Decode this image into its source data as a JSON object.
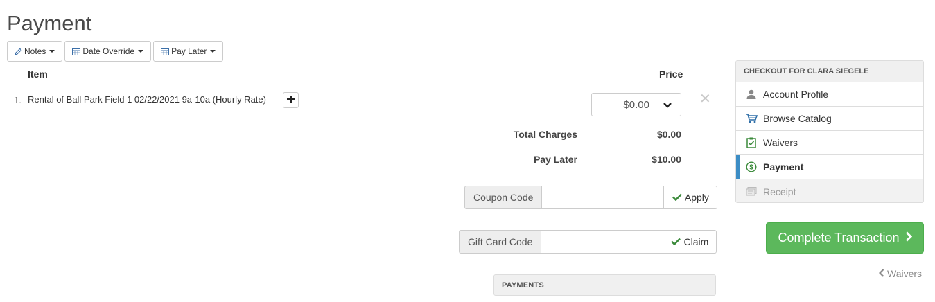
{
  "page": {
    "title": "Payment"
  },
  "toolbar": {
    "notes_label": "Notes",
    "date_override_label": "Date Override",
    "pay_later_label": "Pay Later"
  },
  "table": {
    "headers": {
      "item": "Item",
      "price": "Price"
    },
    "rows": [
      {
        "number": "1.",
        "description": "Rental of Ball Park Field 1 02/22/2021 9a-10a (Hourly Rate)",
        "price_value": "$0.00"
      }
    ]
  },
  "summary": {
    "total_charges_label": "Total Charges",
    "total_charges_value": "$0.00",
    "pay_later_label": "Pay Later",
    "pay_later_value": "$10.00"
  },
  "coupon": {
    "label": "Coupon Code",
    "value": "",
    "button_label": "Apply"
  },
  "gift_card": {
    "label": "Gift Card Code",
    "value": "",
    "button_label": "Claim"
  },
  "payments": {
    "heading": "PAYMENTS"
  },
  "checkout": {
    "heading": "CHECKOUT FOR CLARA SIEGELE",
    "steps": [
      {
        "label": "Account Profile",
        "icon": "user-icon"
      },
      {
        "label": "Browse Catalog",
        "icon": "cart-icon"
      },
      {
        "label": "Waivers",
        "icon": "clipboard-check-icon"
      },
      {
        "label": "Payment",
        "icon": "dollar-circle-icon",
        "active": true
      },
      {
        "label": "Receipt",
        "icon": "receipt-icon",
        "disabled": true
      }
    ]
  },
  "actions": {
    "complete_label": "Complete Transaction",
    "back_label": "Waivers"
  },
  "colors": {
    "primary_success": "#5cb85c",
    "active_step_accent": "#3c8dc5",
    "check_green": "#3a8a3a"
  }
}
